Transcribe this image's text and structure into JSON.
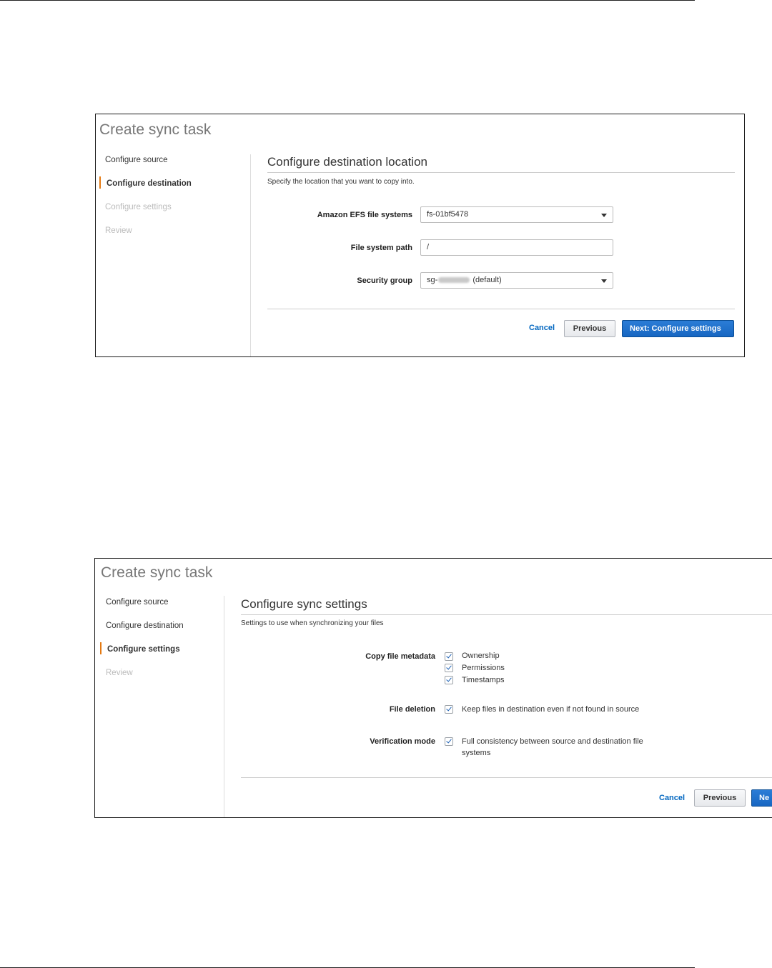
{
  "top_panel": {
    "title": "Create sync task",
    "steps": [
      {
        "label": "Configure source",
        "state": "normal"
      },
      {
        "label": "Configure destination",
        "state": "active"
      },
      {
        "label": "Configure settings",
        "state": "disabled"
      },
      {
        "label": "Review",
        "state": "disabled"
      }
    ],
    "section_title": "Configure destination location",
    "section_desc": "Specify the location that you want to copy into.",
    "fields": {
      "efs_label": "Amazon EFS file systems",
      "efs_value": "fs-01bf5478",
      "path_label": "File system path",
      "path_value": "/",
      "sg_label": "Security group",
      "sg_prefix": "sg-",
      "sg_suffix": "(default)"
    },
    "buttons": {
      "cancel": "Cancel",
      "previous": "Previous",
      "next": "Next: Configure settings"
    }
  },
  "bottom_panel": {
    "title": "Create sync task",
    "steps": [
      {
        "label": "Configure source",
        "state": "normal"
      },
      {
        "label": "Configure destination",
        "state": "normal"
      },
      {
        "label": "Configure settings",
        "state": "active"
      },
      {
        "label": "Review",
        "state": "disabled"
      }
    ],
    "section_title": "Configure sync settings",
    "section_desc": "Settings to use when synchronizing your files",
    "settings": {
      "metadata_label": "Copy file metadata",
      "metadata_options": [
        "Ownership",
        "Permissions",
        "Timestamps"
      ],
      "deletion_label": "File deletion",
      "deletion_option": "Keep files in destination even if not found in source",
      "verification_label": "Verification mode",
      "verification_line1": "Full consistency between source and destination file",
      "verification_line2": "systems"
    },
    "buttons": {
      "cancel": "Cancel",
      "previous": "Previous",
      "next": "Ne"
    }
  },
  "colors": {
    "active_step_marker": "#e47911",
    "primary_button": "#1766c2",
    "link": "#0066c0"
  }
}
